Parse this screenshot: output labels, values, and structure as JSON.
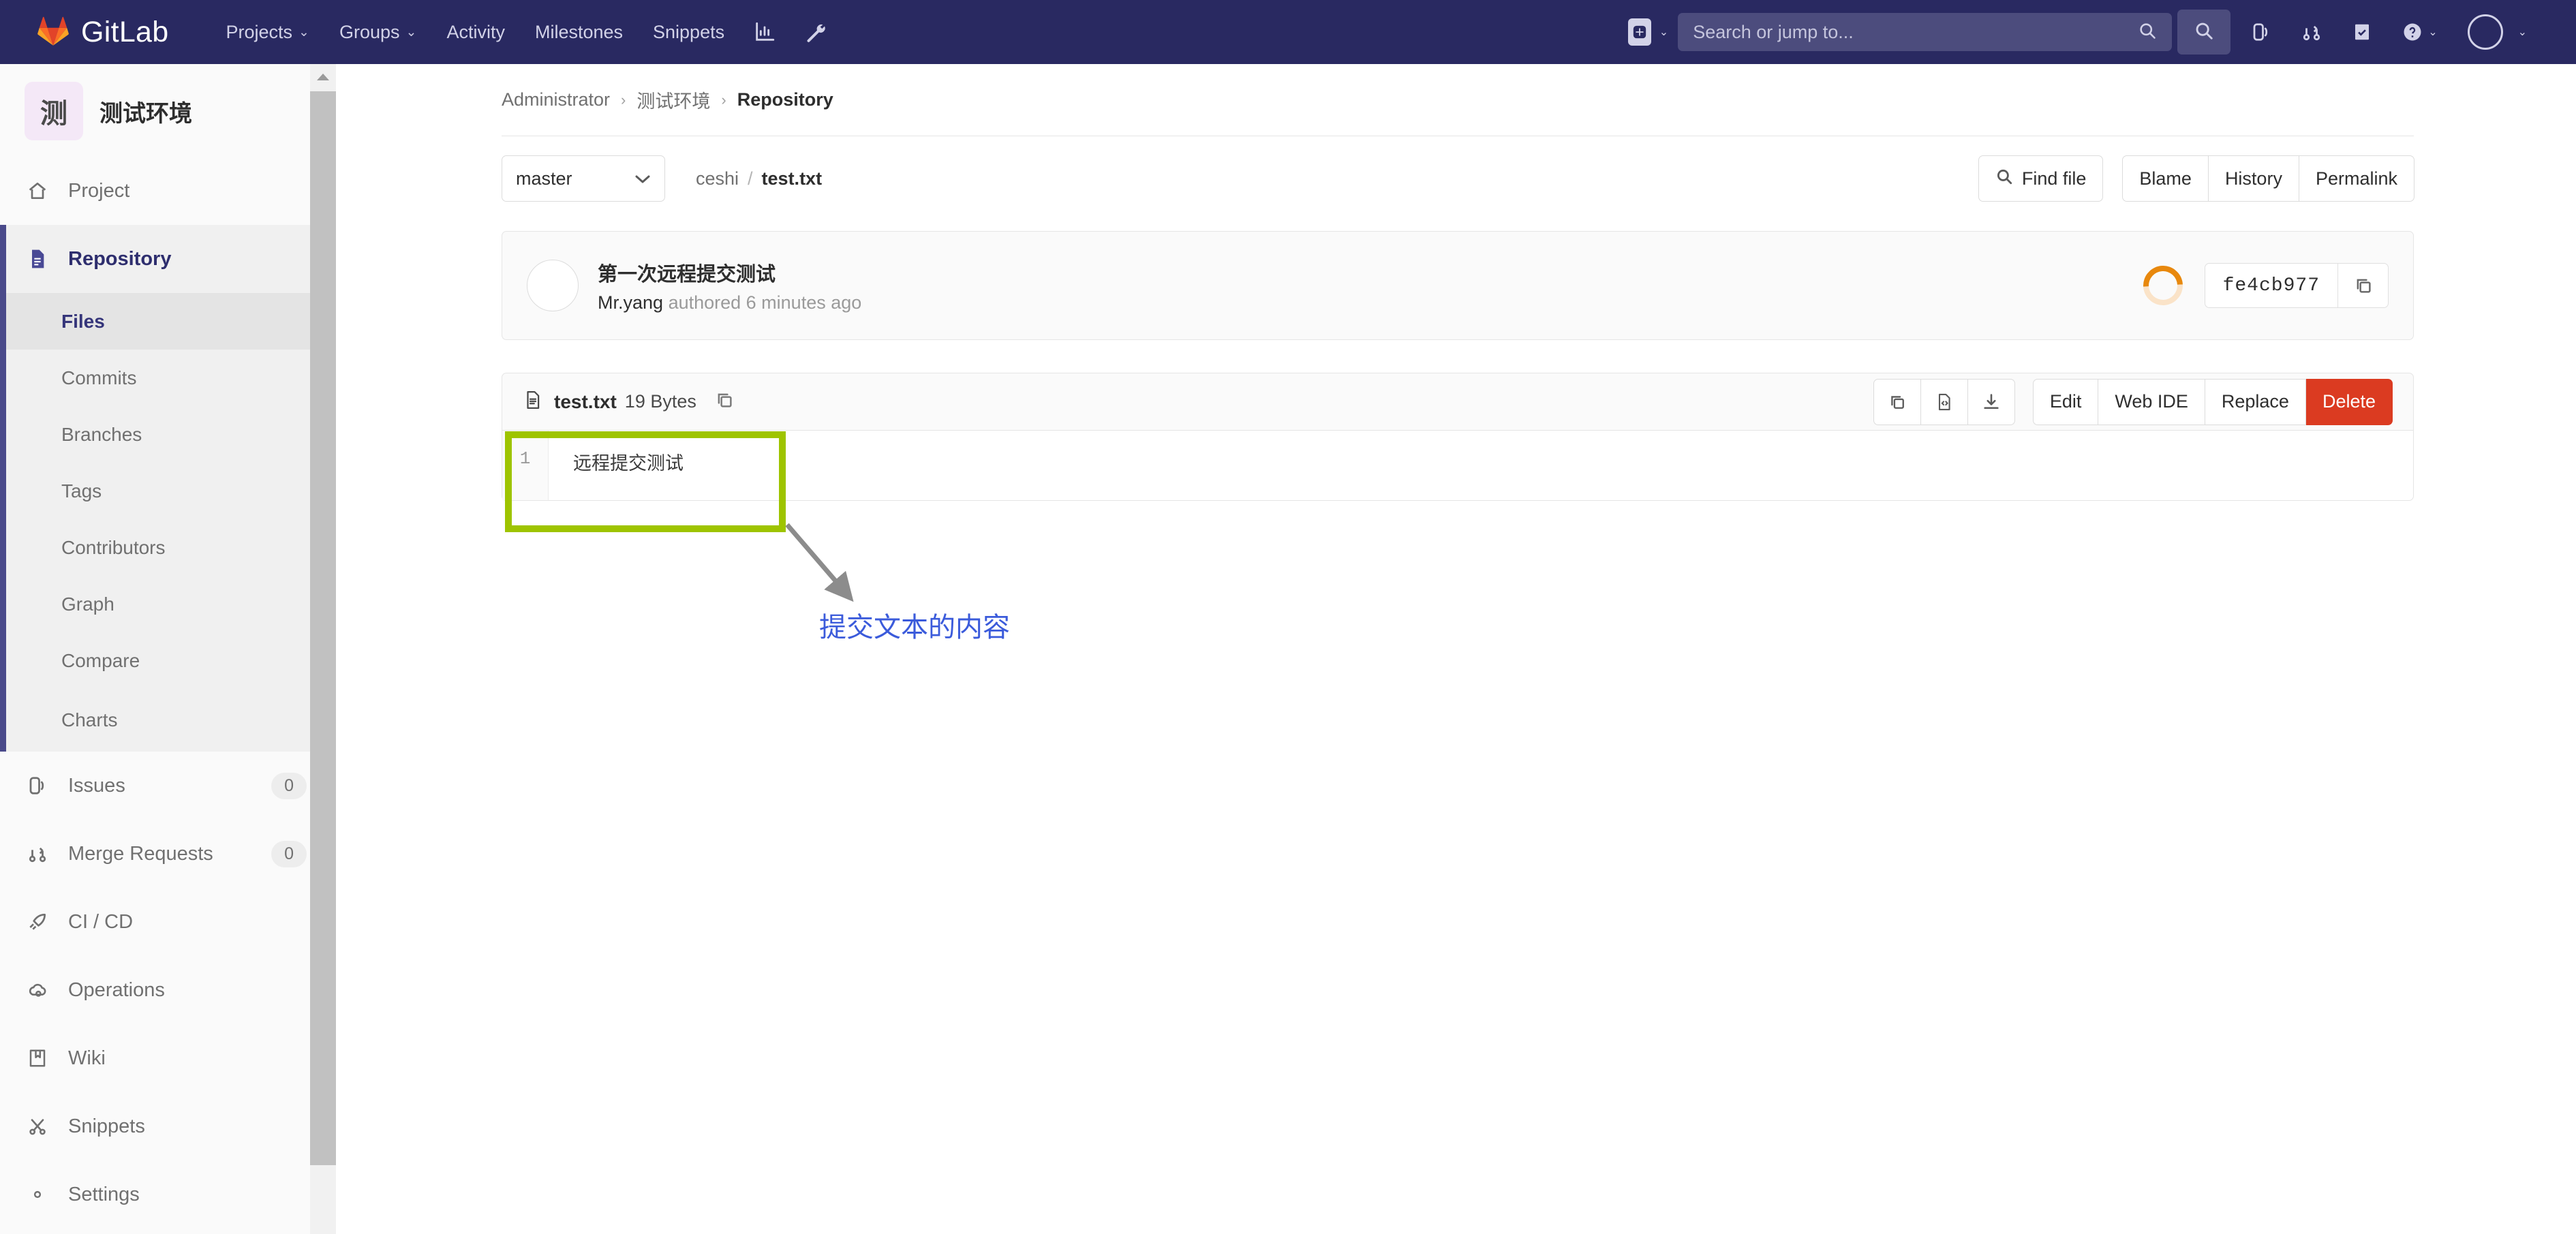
{
  "topnav": {
    "brand": "GitLab",
    "brand_icon": "gitlab-logo-icon",
    "links": [
      {
        "label": "Projects",
        "caret": "⌄",
        "icon": "chevron-down-icon"
      },
      {
        "label": "Groups",
        "caret": "⌄",
        "icon": "chevron-down-icon"
      },
      {
        "label": "Activity",
        "caret": "",
        "icon": ""
      },
      {
        "label": "Milestones",
        "caret": "",
        "icon": ""
      },
      {
        "label": "Snippets",
        "caret": "",
        "icon": ""
      }
    ],
    "icon_links": [
      {
        "name": "analytics-chart-icon"
      },
      {
        "name": "wrench-admin-icon"
      }
    ],
    "new_button_caret": "⌄",
    "search": {
      "placeholder": "Search or jump to...",
      "value": ""
    },
    "tools": [
      {
        "name": "search-icon"
      },
      {
        "name": "issues-icon"
      },
      {
        "name": "merge-requests-icon"
      },
      {
        "name": "todos-icon"
      },
      {
        "name": "help-icon",
        "caret": "⌄"
      }
    ],
    "avatar_caret": "⌄"
  },
  "sidebar": {
    "project": {
      "avatar_letter": "测",
      "name": "测试环境"
    },
    "items": [
      {
        "label": "Project",
        "icon": "home-icon",
        "badge": "",
        "active": false
      },
      {
        "label": "Repository",
        "icon": "document-icon",
        "badge": "",
        "active": true
      },
      {
        "label": "Issues",
        "icon": "issues-icon",
        "badge": "0",
        "active": false
      },
      {
        "label": "Merge Requests",
        "icon": "merge-requests-icon",
        "badge": "0",
        "active": false
      },
      {
        "label": "CI / CD",
        "icon": "rocket-icon",
        "badge": "",
        "active": false
      },
      {
        "label": "Operations",
        "icon": "cloud-gear-icon",
        "badge": "",
        "active": false
      },
      {
        "label": "Wiki",
        "icon": "book-icon",
        "badge": "",
        "active": false
      },
      {
        "label": "Snippets",
        "icon": "scissors-icon",
        "badge": "",
        "active": false
      },
      {
        "label": "Settings",
        "icon": "gear-icon",
        "badge": "",
        "active": false
      }
    ],
    "repository_subitems": [
      {
        "label": "Files",
        "active": true
      },
      {
        "label": "Commits",
        "active": false
      },
      {
        "label": "Branches",
        "active": false
      },
      {
        "label": "Tags",
        "active": false
      },
      {
        "label": "Contributors",
        "active": false
      },
      {
        "label": "Graph",
        "active": false
      },
      {
        "label": "Compare",
        "active": false
      },
      {
        "label": "Charts",
        "active": false
      }
    ]
  },
  "main": {
    "breadcrumb": {
      "owner": "Administrator",
      "project": "测试环境",
      "section": "Repository",
      "separator": "›"
    },
    "filebar": {
      "branch": "master",
      "branch_caret": "⌄",
      "path_dir": "ceshi",
      "path_sep": "/",
      "path_file": "test.txt",
      "find_file_label": "Find file",
      "find_file_icon": "search-icon",
      "blame_label": "Blame",
      "history_label": "History",
      "permalink_label": "Permalink"
    },
    "commit": {
      "title": "第一次远程提交测试",
      "author": "Mr.yang",
      "meta": "authored 6 minutes ago",
      "sha": "fe4cb977",
      "copy_icon": "copy-icon",
      "pipeline_icon": "pipeline-running-spinner"
    },
    "blob": {
      "file_icon": "file-text-icon",
      "filename": "test.txt",
      "size": "19 Bytes",
      "copy_path_icon": "copy-icon",
      "action_icons": [
        {
          "name": "copy-contents-icon"
        },
        {
          "name": "view-source-icon"
        },
        {
          "name": "download-icon"
        }
      ],
      "edit_label": "Edit",
      "web_ide_label": "Web IDE",
      "replace_label": "Replace",
      "delete_label": "Delete",
      "lines": [
        {
          "number": "1",
          "text": "远程提交测试"
        }
      ]
    }
  },
  "annotation": {
    "text": "提交文本的内容",
    "box_color": "#9ec400",
    "text_color": "#3b5bdb",
    "arrow_color": "#8c8c8c"
  },
  "colors": {
    "nav_bg": "#292961",
    "accent_purple": "#4a4a8a",
    "danger_red": "#db3b21",
    "spinner_orange": "#e8880d",
    "annotation_green": "#9ec400",
    "annotation_blue": "#3b5bdb"
  }
}
